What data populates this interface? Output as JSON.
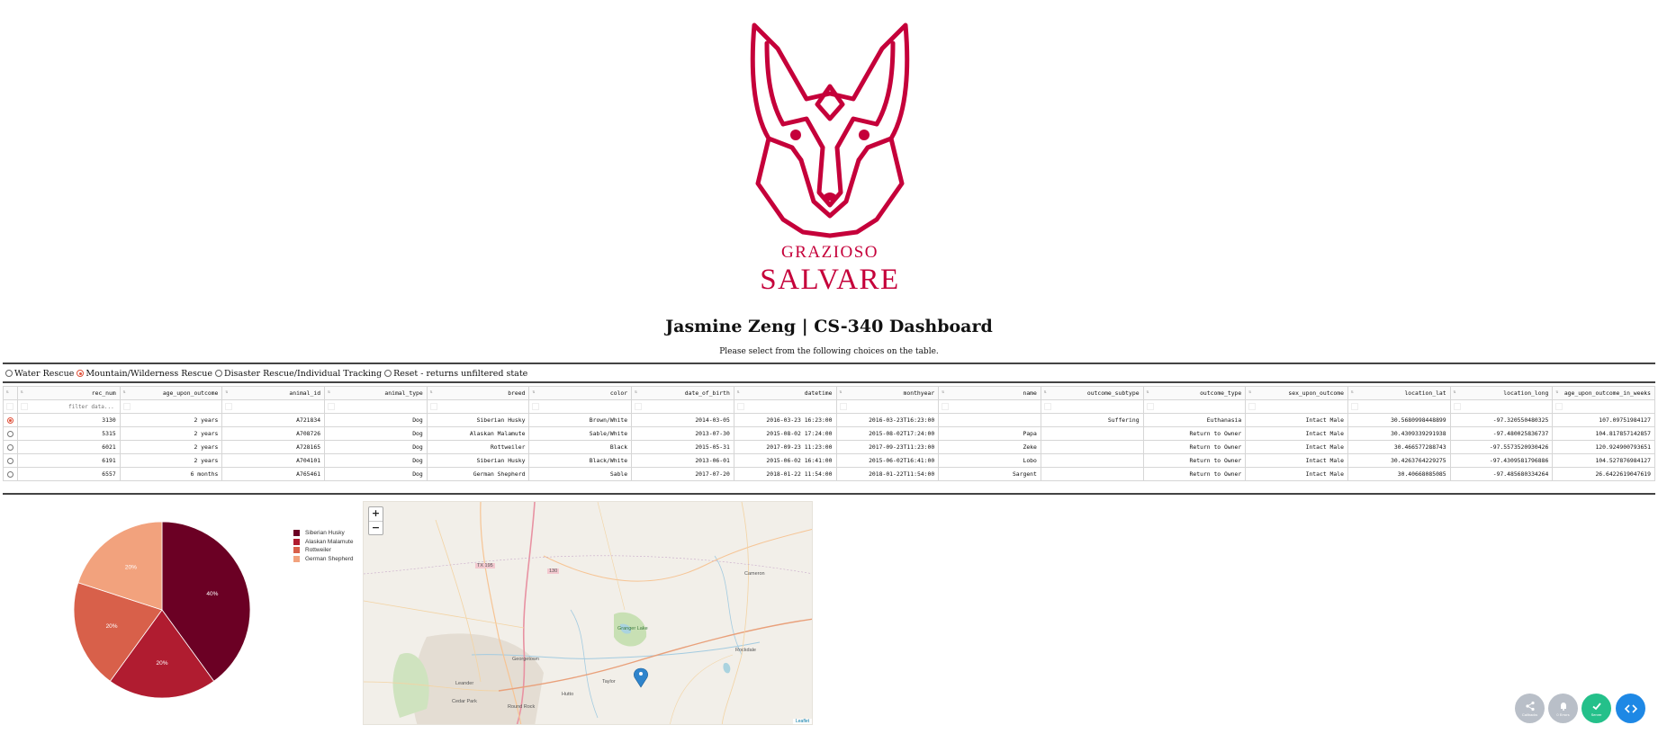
{
  "logo": {
    "line1": "GRAZIOSO",
    "line2": "SALVARE",
    "color": "#c5003a"
  },
  "header": {
    "title": "Jasmine Zeng | CS-340 Dashboard",
    "instructions": "Please select from the following choices on the table."
  },
  "filter": {
    "options": [
      {
        "label": "Water Rescue",
        "selected": false
      },
      {
        "label": "Mountain/Wilderness Rescue",
        "selected": true
      },
      {
        "label": "Disaster Rescue/Individual Tracking",
        "selected": false
      },
      {
        "label": "Reset - returns unfiltered state",
        "selected": false
      }
    ]
  },
  "table": {
    "columns": [
      "rec_num",
      "age_upon_outcome",
      "animal_id",
      "animal_type",
      "breed",
      "color",
      "date_of_birth",
      "datetime",
      "monthyear",
      "name",
      "outcome_subtype",
      "outcome_type",
      "sex_upon_outcome",
      "location_lat",
      "location_long",
      "age_upon_outcome_in_weeks"
    ],
    "filter_placeholder": "filter data...",
    "rows": [
      {
        "selected": true,
        "cells": [
          "3130",
          "2 years",
          "A721834",
          "Dog",
          "Siberian Husky",
          "Brown/White",
          "2014-03-05",
          "2016-03-23 16:23:00",
          "2016-03-23T16:23:00",
          "",
          "Suffering",
          "Euthanasia",
          "Intact Male",
          "30.5680998448899",
          "-97.320550480325",
          "107.09751984127"
        ]
      },
      {
        "selected": false,
        "cells": [
          "5315",
          "2 years",
          "A708726",
          "Dog",
          "Alaskan Malamute",
          "Sable/White",
          "2013-07-30",
          "2015-08-02 17:24:00",
          "2015-08-02T17:24:00",
          "Papa",
          "",
          "Return to Owner",
          "Intact Male",
          "30.4309339291938",
          "-97.480025836737",
          "104.817857142857"
        ]
      },
      {
        "selected": false,
        "cells": [
          "6021",
          "2 years",
          "A728165",
          "Dog",
          "Rottweiler",
          "Black",
          "2015-05-31",
          "2017-09-23 11:23:00",
          "2017-09-23T11:23:00",
          "Zeke",
          "",
          "Return to Owner",
          "Intact Male",
          "30.466577288743",
          "-97.5573520930426",
          "120.924900793651"
        ]
      },
      {
        "selected": false,
        "cells": [
          "6191",
          "2 years",
          "A704101",
          "Dog",
          "Siberian Husky",
          "Black/White",
          "2013-06-01",
          "2015-06-02 16:41:00",
          "2015-06-02T16:41:00",
          "Lobo",
          "",
          "Return to Owner",
          "Intact Male",
          "30.4263764229275",
          "-97.4309581796886",
          "104.527876984127"
        ]
      },
      {
        "selected": false,
        "cells": [
          "6557",
          "6 months",
          "A765461",
          "Dog",
          "German Shepherd",
          "Sable",
          "2017-07-20",
          "2018-01-22 11:54:00",
          "2018-01-22T11:54:00",
          "Sargent",
          "",
          "Return to Owner",
          "Intact Male",
          "30.40668085085",
          "-97.485680334264",
          "26.6422619047619"
        ]
      }
    ]
  },
  "chart_data": {
    "type": "pie",
    "categories": [
      "Siberian Husky",
      "Alaskan Malamute",
      "Rottweiler",
      "German Shepherd"
    ],
    "values": [
      40,
      20,
      20,
      20
    ],
    "value_labels": [
      "40%",
      "20%",
      "20%",
      "20%"
    ],
    "colors": [
      "#6b0024",
      "#b01c30",
      "#d8604a",
      "#f2a27d"
    ],
    "legend_position": "right"
  },
  "map": {
    "zoom_in_label": "+",
    "zoom_out_label": "−",
    "attribution": "Leaflet",
    "place_labels": [
      "Georgetown",
      "Round Rock",
      "Cedar Park",
      "Leander",
      "Taylor",
      "Hutto",
      "Rockdale",
      "Cameron",
      "Granger Lake",
      "TX 195",
      "130"
    ]
  },
  "floating_buttons": [
    {
      "label": "Callbacks",
      "icon": "share-icon",
      "color": "#b9bfc8"
    },
    {
      "label": "0 Errors",
      "icon": "bell-icon",
      "color": "#b9bfc8"
    },
    {
      "label": "Server",
      "icon": "check-icon",
      "color": "#24c08a"
    },
    {
      "label": "",
      "icon": "code-icon",
      "color": "#1e88e5"
    }
  ]
}
